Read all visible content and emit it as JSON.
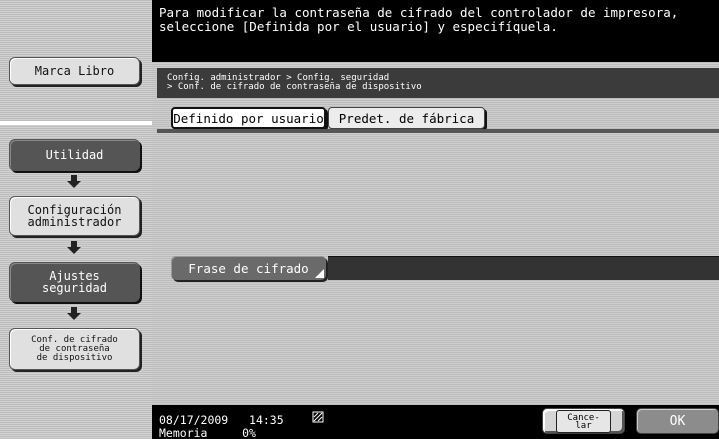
{
  "header": {
    "message_line1": "Para modificar la contraseña de cifrado del controlador de impresora,",
    "message_line2": "seleccione [Definida por el usuario] y especifíquela."
  },
  "sidebar": {
    "bookmark_label": "Marca Libro",
    "steps": [
      {
        "label": "Utilidad"
      },
      {
        "label_line1": "Configuración",
        "label_line2": "administrador"
      },
      {
        "label_line1": "Ajustes",
        "label_line2": "seguridad"
      },
      {
        "label_line1": "Conf. de cifrado",
        "label_line2": "de contraseña",
        "label_line3": "de dispositivo"
      }
    ],
    "arrow_icon": "down-arrow-icon"
  },
  "breadcrumb": {
    "line1": "Config. administrador > Config. seguridad",
    "line2": "> Conf. de cifrado de contraseña de dispositivo"
  },
  "tabs": [
    {
      "label": "Definido por usuario",
      "selected": true
    },
    {
      "label": "Predet. de fábrica",
      "selected": false
    }
  ],
  "passphrase": {
    "button_label": "Frase de cifrado",
    "value": ""
  },
  "status": {
    "date": "08/17/2009",
    "time": "14:35",
    "memory_label": "Memoria",
    "memory_value": "0%",
    "toner_icon": "toner-icon"
  },
  "footer": {
    "cancel_line1": "Cance-",
    "cancel_line2": "lar",
    "ok_label": "OK"
  },
  "colors": {
    "header_bg": "#000000",
    "panel_bg": "#c6c6c6",
    "breadcrumb_bg": "#3b3b3b",
    "field_button_bg": "#6a6a6a",
    "ok_button_bg": "#8c8c8c"
  }
}
